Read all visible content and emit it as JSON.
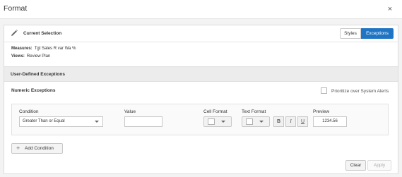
{
  "dialog": {
    "title": "Format",
    "close_icon": "close-icon",
    "close_glyph": "×"
  },
  "selection": {
    "title": "Current Selection",
    "icon": "pencil-icon",
    "tabs": [
      {
        "label": "Styles",
        "active": false
      },
      {
        "label": "Exceptions",
        "active": true
      }
    ],
    "measures_label": "Measures:",
    "measures_value": "Tgt Sales R var Wa %",
    "views_label": "Views:",
    "views_value": "Review Plan"
  },
  "exceptions": {
    "section_title": "User-Defined Exceptions",
    "numeric_title": "Numeric Exceptions",
    "prioritize_label": "Prioritize over System Alerts",
    "prioritize_checked": false
  },
  "condition_row": {
    "condition_label": "Condition",
    "condition_value": "Greater Than or Equal",
    "value_label": "Value",
    "value_value": "",
    "cell_format_label": "Cell Format",
    "text_format_label": "Text Format",
    "bold_label": "B",
    "italic_label": "I",
    "underline_label": "U",
    "preview_label": "Preview",
    "preview_value": "1234.56"
  },
  "actions": {
    "add_condition_label": "Add Condition",
    "add_glyph": "+",
    "clear_label": "Clear",
    "apply_label": "Apply"
  },
  "colors": {
    "accent": "#1f75c4",
    "section_bg": "#ececec"
  }
}
